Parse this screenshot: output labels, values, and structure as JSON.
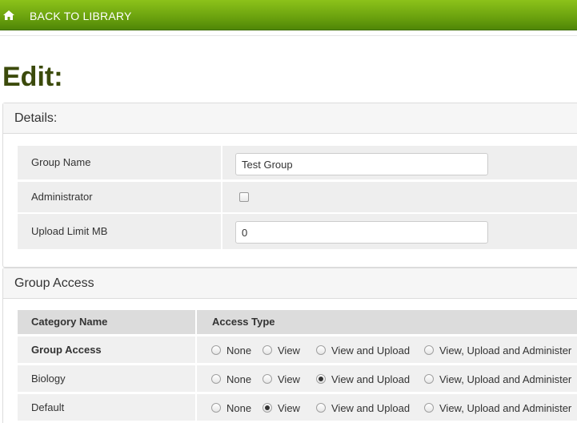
{
  "topbar": {
    "home_icon": "home-icon",
    "back_label": "BACK TO LIBRARY"
  },
  "page": {
    "title": "Edit:"
  },
  "details": {
    "heading": "Details:",
    "fields": {
      "group_name": {
        "label": "Group Name",
        "value": "Test Group"
      },
      "administrator": {
        "label": "Administrator",
        "checked": false
      },
      "upload_limit": {
        "label": "Upload Limit MB",
        "value": "0"
      }
    }
  },
  "group_access": {
    "heading": "Group Access",
    "columns": [
      "Category Name",
      "Access Type"
    ],
    "options": [
      "None",
      "View",
      "View and Upload",
      "View, Upload and Administer"
    ],
    "rows": [
      {
        "name": "Group Access",
        "bold": true,
        "selected": null
      },
      {
        "name": "Biology",
        "bold": false,
        "selected": "View and Upload"
      },
      {
        "name": "Default",
        "bold": false,
        "selected": "View"
      }
    ]
  },
  "colors": {
    "topbar_green": "#6aa10e",
    "title_green": "#3b4a0b"
  }
}
